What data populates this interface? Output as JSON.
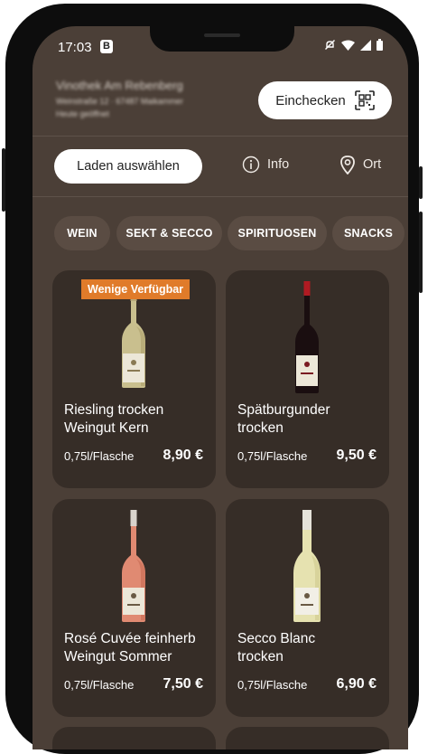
{
  "status_bar": {
    "time": "17:03",
    "badge": "B"
  },
  "store": {
    "name": "Vinothek Am Rebenberg",
    "address": "Weinstraße 12 · 67487 Maikammer",
    "hours": "Heute geöffnet",
    "checkin_label": "Einchecken"
  },
  "actions": {
    "select_store": "Laden auswählen",
    "info": "Info",
    "location": "Ort"
  },
  "tabs": [
    {
      "label": "WEIN"
    },
    {
      "label": "SEKT & SECCO"
    },
    {
      "label": "SPIRITUOSEN"
    },
    {
      "label": "SNACKS"
    }
  ],
  "products": [
    {
      "badge": "Wenige Verfügbar",
      "name_line1": "Riesling trocken",
      "name_line2": "Weingut Kern",
      "size": "0,75l/Flasche",
      "price": "8,90 €",
      "bottle": "white-wine"
    },
    {
      "badge": "",
      "name_line1": "Spätburgunder",
      "name_line2": "trocken",
      "size": "0,75l/Flasche",
      "price": "9,50 €",
      "bottle": "red-wine"
    },
    {
      "badge": "",
      "name_line1": "Rosé Cuvée feinherb",
      "name_line2": "Weingut Sommer",
      "size": "0,75l/Flasche",
      "price": "7,50 €",
      "bottle": "rose-wine"
    },
    {
      "badge": "",
      "name_line1": "Secco Blanc",
      "name_line2": "trocken",
      "size": "0,75l/Flasche",
      "price": "6,90 €",
      "bottle": "secco"
    }
  ],
  "colors": {
    "background": "#4b3f37",
    "card": "#362d27",
    "badge": "#e07b2a"
  }
}
